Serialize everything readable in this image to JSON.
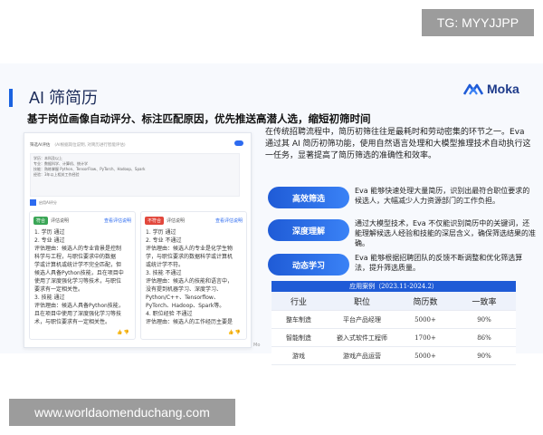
{
  "watermark_top": "TG: MYYJJPP",
  "watermark_bottom": "www.worldaomenduchang.com",
  "slide": {
    "title": "AI 筛简历",
    "logo_text": "Moka",
    "subtitle": "基于岗位画像自动评分、标注匹配原因，优先推送高潜人选，缩短初筛时间"
  },
  "screenshot": {
    "header_label": "筛选AI评估",
    "header_hint": "(AI根据岗位说明, 对简历进行智能评估)",
    "requirements": [
      "学历：本科及以上",
      "专业：数据科学、计算机、统计学",
      "技能：熟练掌握 Python、TensorFlow、PyTorch、Hadoop、Spark",
      "经验：3年以上相关工作经验"
    ],
    "checkbox_label": "启用AI评分",
    "left_card": {
      "tag": "符合",
      "head_label": "评估说明",
      "link": "查看评估说明",
      "lines": [
        "1. 学历 通过",
        "2. 专业 通过",
        "评估理由：候选人的专业背景是控制",
        "科学与工程，与职位要求中的数据",
        "学或计算机或统计学不完全匹配，但",
        "候选人具备Python技能，且在项目中",
        "使用了深度强化学习等技术，与职位",
        "要求有一定相关性。",
        "3. 技能 通过",
        "评估理由：候选人具备Python技能，",
        "且在项目中使用了深度强化学习等技",
        "术，与职位要求有一定相关性。"
      ]
    },
    "right_card": {
      "tag": "不符合",
      "head_label": "评估说明",
      "link": "查看评估说明",
      "lines": [
        "1. 学历 通过",
        "2. 专业 不通过",
        "评估理由：候选人的专业是化学生物",
        "学，与职位要求的数据科学或计算机",
        "或统计学不符。",
        "3. 技能 不通过",
        "评估理由：候选人的技能和语言中，",
        "没有提到机器学习、深度学习、",
        "Python/C++、Tensorflow、",
        "PyTorch、Hadoop、Spark等。",
        "4. 职位经验 不通过",
        "评估理由：候选人的工作经历主要是"
      ]
    },
    "caption": "Mo"
  },
  "intro": "在传统招聘流程中，简历初筛往往是最耗时和劳动密集的环节之一。Eva 通过其 AI 简历初筛功能，使用自然语言处理和大模型推理技术自动执行这一任务，显著提高了简历筛选的准确性和效率。",
  "features": [
    {
      "label": "高效筛选",
      "desc": "Eva 能够快速处理大量简历，识别出最符合职位要求的候选人，大幅减少人力资源部门的工作负担。"
    },
    {
      "label": "深度理解",
      "desc": "通过大模型技术，Eva 不仅能识别简历中的关键词，还能理解候选人经验和技能的深层含义，确保筛选结果的准确。"
    },
    {
      "label": "动态学习",
      "desc": "Eva 能够根据招聘团队的反馈不断调整和优化筛选算法，提升筛选质量。"
    }
  ],
  "cases": {
    "title": "应用案例（2023.11-2024.2）",
    "columns": [
      "行业",
      "职位",
      "简历数",
      "一致率"
    ],
    "rows": [
      [
        "整车制造",
        "平台产品经理",
        "5000+",
        "90%"
      ],
      [
        "智能制造",
        "嵌入式软件工程师",
        "1700+",
        "86%"
      ],
      [
        "游戏",
        "游戏产品运营",
        "5000+",
        "90%"
      ]
    ]
  },
  "colors": {
    "accent": "#1f5bd6",
    "pass": "#3aa656",
    "fail": "#e2483d"
  }
}
